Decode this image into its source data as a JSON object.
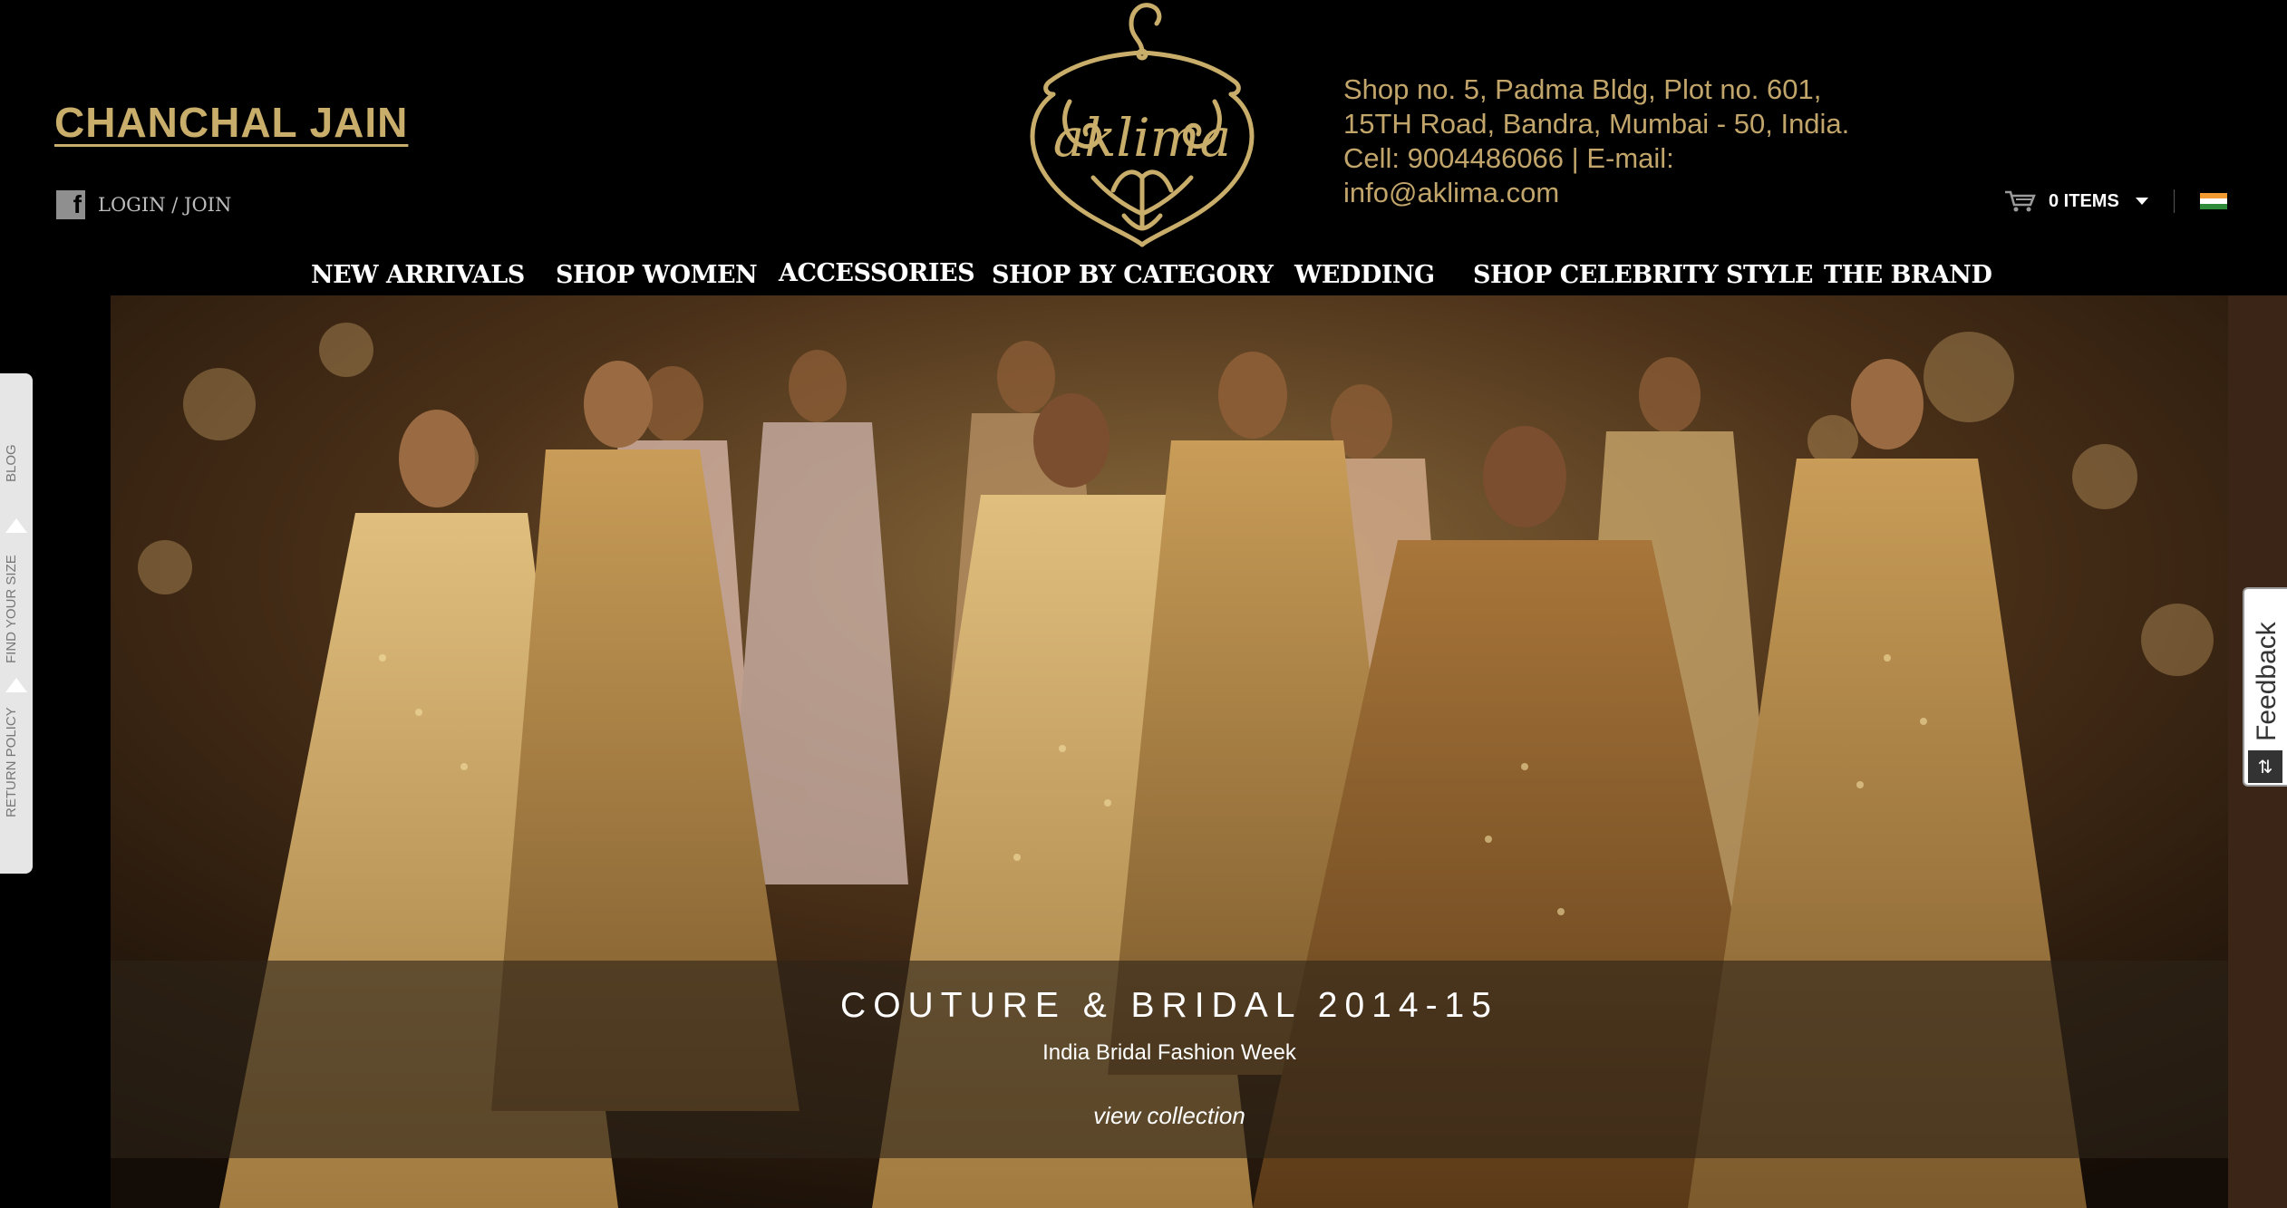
{
  "header": {
    "designer_name": "CHANCHAL JAIN",
    "login_label": "LOGIN / JOIN",
    "brand_logo_text": "aklima",
    "address_lines": [
      "Shop no. 5, Padma Bldg, Plot no. 601,",
      "15TH Road, Bandra, Mumbai - 50, India.",
      "Cell: 9004486066 | E-mail:",
      "info@aklima.com"
    ],
    "cart_label": "0 ITEMS",
    "cart_icon": "cart-icon",
    "flag_icon": "india-flag-icon",
    "accent_color": "#c9ad6a"
  },
  "nav": {
    "items": [
      {
        "label": "NEW ARRIVALS"
      },
      {
        "label": "SHOP WOMEN"
      },
      {
        "label": "ACCESSORIES"
      },
      {
        "label": "SHOP BY CATEGORY"
      },
      {
        "label": "WEDDING"
      },
      {
        "label": "SHOP CELEBRITY STYLE"
      },
      {
        "label": "THE BRAND"
      }
    ]
  },
  "hero": {
    "title": "COUTURE & BRIDAL 2014-15",
    "subtitle": "India Bridal Fashion Week",
    "link_label": "view collection"
  },
  "side_tab": {
    "items": [
      {
        "label": "BLOG"
      },
      {
        "label": "FIND YOUR SIZE"
      },
      {
        "label": "RETURN POLICY"
      }
    ]
  },
  "feedback": {
    "label": "Feedback"
  }
}
